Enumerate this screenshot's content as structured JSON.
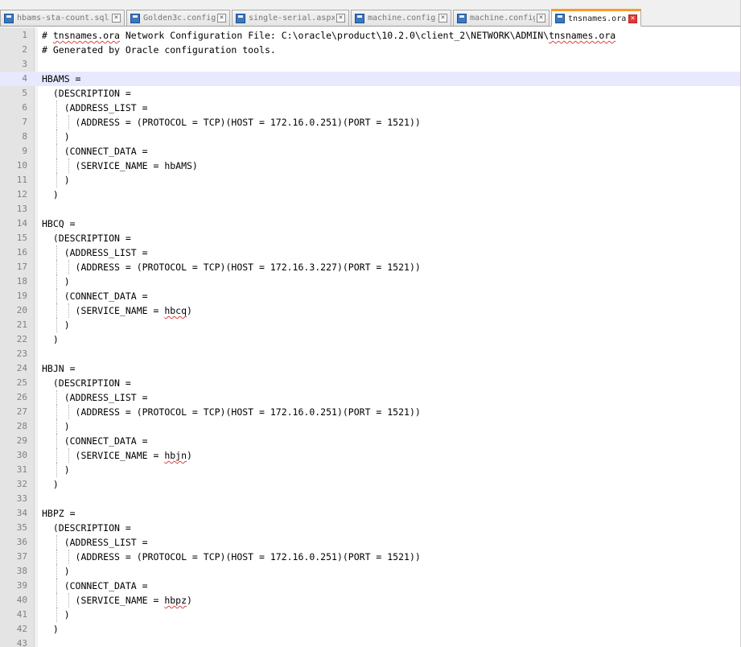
{
  "tabs": [
    {
      "label": "hbams-sta-count.sql",
      "active": false
    },
    {
      "label": "Golden3c.config",
      "active": false
    },
    {
      "label": "single-serial.aspx",
      "active": false
    },
    {
      "label": "machine.config",
      "active": false
    },
    {
      "label": "machine.config",
      "active": false
    },
    {
      "label": "tnsnames.ora",
      "active": true
    }
  ],
  "editor": {
    "current_line": 4,
    "lines": [
      {
        "n": "1",
        "text": "# tnsnames.ora Network Configuration File: C:\\oracle\\product\\10.2.0\\client_2\\NETWORK\\ADMIN\\tnsnames.ora"
      },
      {
        "n": "2",
        "text": "# Generated by Oracle configuration tools."
      },
      {
        "n": "3",
        "text": ""
      },
      {
        "n": "4",
        "text": "HBAMS ="
      },
      {
        "n": "5",
        "text": "  (DESCRIPTION ="
      },
      {
        "n": "6",
        "text": "    (ADDRESS_LIST ="
      },
      {
        "n": "7",
        "text": "      (ADDRESS = (PROTOCOL = TCP)(HOST = 172.16.0.251)(PORT = 1521))"
      },
      {
        "n": "8",
        "text": "    )"
      },
      {
        "n": "9",
        "text": "    (CONNECT_DATA ="
      },
      {
        "n": "10",
        "text": "      (SERVICE_NAME = hbAMS)"
      },
      {
        "n": "11",
        "text": "    )"
      },
      {
        "n": "12",
        "text": "  )"
      },
      {
        "n": "13",
        "text": ""
      },
      {
        "n": "14",
        "text": "HBCQ ="
      },
      {
        "n": "15",
        "text": "  (DESCRIPTION ="
      },
      {
        "n": "16",
        "text": "    (ADDRESS_LIST ="
      },
      {
        "n": "17",
        "text": "      (ADDRESS = (PROTOCOL = TCP)(HOST = 172.16.3.227)(PORT = 1521))"
      },
      {
        "n": "18",
        "text": "    )"
      },
      {
        "n": "19",
        "text": "    (CONNECT_DATA ="
      },
      {
        "n": "20",
        "text": "      (SERVICE_NAME = hbcq)"
      },
      {
        "n": "21",
        "text": "    )"
      },
      {
        "n": "22",
        "text": "  )"
      },
      {
        "n": "23",
        "text": ""
      },
      {
        "n": "24",
        "text": "HBJN ="
      },
      {
        "n": "25",
        "text": "  (DESCRIPTION ="
      },
      {
        "n": "26",
        "text": "    (ADDRESS_LIST ="
      },
      {
        "n": "27",
        "text": "      (ADDRESS = (PROTOCOL = TCP)(HOST = 172.16.0.251)(PORT = 1521))"
      },
      {
        "n": "28",
        "text": "    )"
      },
      {
        "n": "29",
        "text": "    (CONNECT_DATA ="
      },
      {
        "n": "30",
        "text": "      (SERVICE_NAME = hbjn)"
      },
      {
        "n": "31",
        "text": "    )"
      },
      {
        "n": "32",
        "text": "  )"
      },
      {
        "n": "33",
        "text": ""
      },
      {
        "n": "34",
        "text": "HBPZ ="
      },
      {
        "n": "35",
        "text": "  (DESCRIPTION ="
      },
      {
        "n": "36",
        "text": "    (ADDRESS_LIST ="
      },
      {
        "n": "37",
        "text": "      (ADDRESS = (PROTOCOL = TCP)(HOST = 172.16.0.251)(PORT = 1521))"
      },
      {
        "n": "38",
        "text": "    )"
      },
      {
        "n": "39",
        "text": "    (CONNECT_DATA ="
      },
      {
        "n": "40",
        "text": "      (SERVICE_NAME = hbpz)"
      },
      {
        "n": "41",
        "text": "    )"
      },
      {
        "n": "42",
        "text": "  )"
      },
      {
        "n": "43",
        "text": ""
      }
    ]
  },
  "colors": {
    "active_tab_accent": "#fa9a2c",
    "current_line_bg": "#e8e8ff",
    "gutter_bg": "#e4e4e4"
  }
}
